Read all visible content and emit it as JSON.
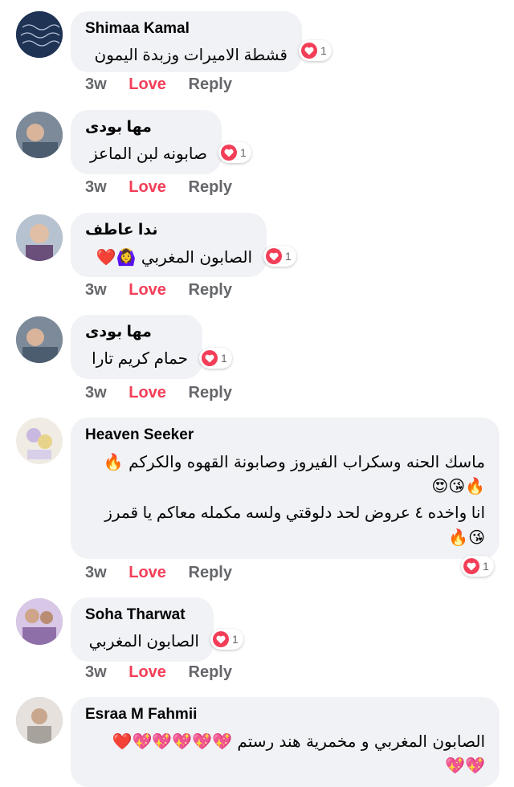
{
  "comments": [
    {
      "name": "Shimaa Kamal",
      "lines": [
        "قشطة الاميرات وزبدة اليمون"
      ],
      "reactions": "1",
      "time": "3w",
      "love": "Love",
      "reply": "Reply"
    },
    {
      "name": "مها بودى",
      "lines": [
        "صابونه لبن الماعز"
      ],
      "reactions": "1",
      "time": "3w",
      "love": "Love",
      "reply": "Reply"
    },
    {
      "name": "ندا عاطف",
      "lines": [
        "الصابون المغربي 🙆‍♀️❤️"
      ],
      "reactions": "1",
      "time": "3w",
      "love": "Love",
      "reply": "Reply"
    },
    {
      "name": "مها بودى",
      "lines": [
        "حمام كريم تارا"
      ],
      "reactions": "1",
      "time": "3w",
      "love": "Love",
      "reply": "Reply"
    },
    {
      "name": "Heaven Seeker",
      "lines": [
        "ماسك الحنه وسكراب الفيروز وصابونة القهوه والكركم 🔥",
        "🔥😘😍",
        "انا واخده ٤ عروض لحد دلوقتي ولسه مكمله معاكم يا قمرز",
        "😘🔥"
      ],
      "reactions": "1",
      "time": "3w",
      "love": "Love",
      "reply": "Reply"
    },
    {
      "name": "Soha Tharwat",
      "lines": [
        "الصابون المغربي"
      ],
      "reactions": "1",
      "time": "3w",
      "love": "Love",
      "reply": "Reply"
    },
    {
      "name": "Esraa M Fahmii",
      "lines": [
        "الصابون المغربي و مخمرية هند رستم 💖💖💖💖💖❤️",
        "💖💖"
      ],
      "reactions": "",
      "time": "",
      "love": "",
      "reply": ""
    }
  ]
}
